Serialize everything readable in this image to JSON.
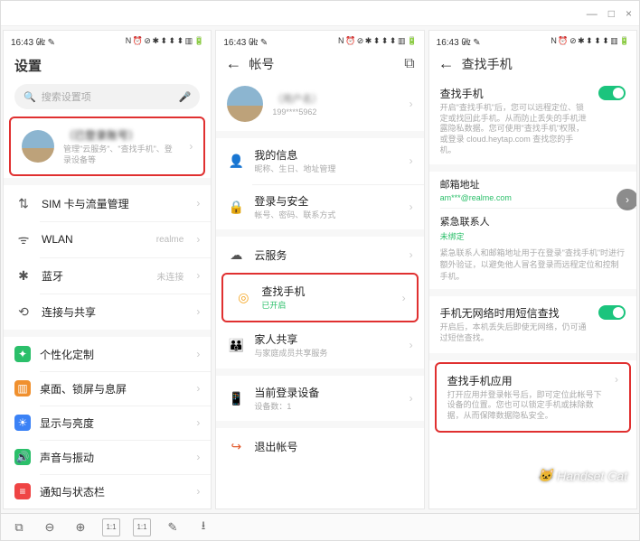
{
  "window": {
    "sys_min": "—",
    "sys_max": "□",
    "sys_close": "×"
  },
  "status": {
    "time": "16:43",
    "suffix": "㎓ ✎",
    "right": "N ⏰ ⊘ ✱ ⬍ ⬍ ⬍ ▥ 🔋"
  },
  "screen1": {
    "title": "设置",
    "search_placeholder": "搜索设置项",
    "account": {
      "name": "（已登录账号）",
      "sub": "管理\"云服务\"、\"查找手机\"、登录设备等"
    },
    "items": [
      {
        "icon": "↑↓",
        "label": "SIM 卡与流量管理",
        "value": ""
      },
      {
        "icon": "ᯤ",
        "label": "WLAN",
        "value": "realme"
      },
      {
        "icon": "✱",
        "label": "蓝牙",
        "value": "未连接"
      },
      {
        "icon": "⟲",
        "label": "连接与共享",
        "value": ""
      }
    ],
    "items2": [
      {
        "icon": "✦",
        "color": "#2bbf6a",
        "label": "个性化定制"
      },
      {
        "icon": "▥",
        "color": "#f0902e",
        "label": "桌面、锁屏与息屏"
      },
      {
        "icon": "☀",
        "color": "#3b82f6",
        "label": "显示与亮度"
      },
      {
        "icon": "🔊",
        "color": "#2bbf6a",
        "label": "声音与振动"
      },
      {
        "icon": "≡",
        "color": "#ef4444",
        "label": "通知与状态栏"
      }
    ]
  },
  "screen2": {
    "title": "帐号",
    "account": {
      "name": "（用户名）",
      "phone": "199****5962"
    },
    "items": [
      {
        "icon": "👤",
        "label": "我的信息",
        "sub": "昵称、生日、地址管理"
      },
      {
        "icon": "🔒",
        "label": "登录与安全",
        "sub": "帐号、密码、联系方式"
      }
    ],
    "items2": [
      {
        "icon": "☁",
        "label": "云服务",
        "sub": ""
      },
      {
        "icon": "◎",
        "label": "查找手机",
        "sub": "已开启",
        "sub_green": true,
        "highlight": true
      },
      {
        "icon": "👪",
        "label": "家人共享",
        "sub": "与家庭成员共享服务"
      }
    ],
    "items3": [
      {
        "icon": "📱",
        "label": "当前登录设备",
        "sub": "设备数：1"
      }
    ],
    "logout": {
      "icon": "↪",
      "label": "退出帐号"
    }
  },
  "screen3": {
    "title": "查找手机",
    "main": {
      "heading": "查找手机",
      "desc": "开启\"查找手机\"后，您可以远程定位、锁定或找回此手机。从而防止丢失的手机泄露隐私数据。您可使用\"查找手机\"权限，或登录 cloud.heytap.com 查找您的手机。"
    },
    "email": {
      "label": "邮箱地址",
      "value": "am***@realme.com"
    },
    "contact": {
      "label": "紧急联系人",
      "value": "未绑定"
    },
    "note": "紧急联系人和邮箱地址用于在登录\"查找手机\"时进行额外验证，以避免他人冒名登录而远程定位和控制手机。",
    "sms": {
      "heading": "手机无网络时用短信查找",
      "desc": "开启后，本机丢失后即使无网络，仍可通过短信查找。"
    },
    "app": {
      "heading": "查找手机应用",
      "desc": "打开应用并登录帐号后，即可定位此帐号下设备的位置。您也可以锁定手机或抹除数据，从而保障数据隐私安全。"
    }
  },
  "toolbar": {
    "labels": [
      "screenshot",
      "zoom-out",
      "zoom-in",
      "fit-1-1",
      "reset-1-1",
      "edit",
      "download"
    ]
  },
  "watermark": "Handset Cat"
}
